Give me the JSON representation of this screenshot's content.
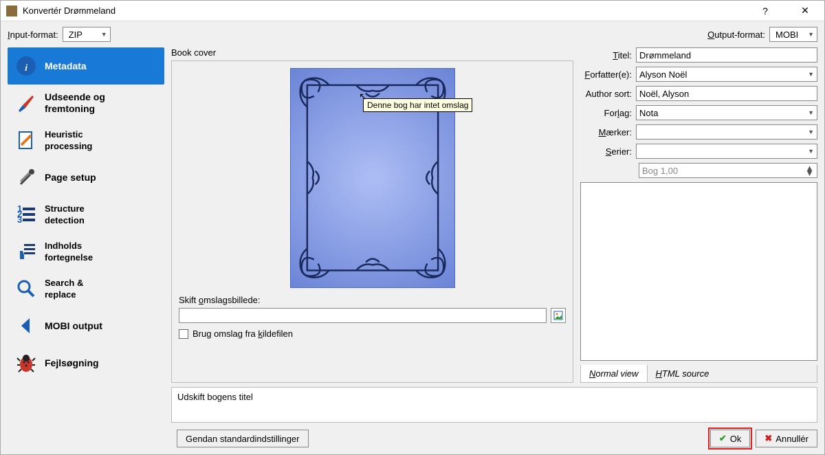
{
  "window": {
    "title": "Konvertér Drømmeland"
  },
  "formatbar": {
    "input_label_u": "I",
    "input_label_rest": "nput-format:",
    "input_value": "ZIP",
    "output_label_u": "O",
    "output_label_rest": "utput-format:",
    "output_value": "MOBI"
  },
  "sidebar": {
    "items": [
      {
        "label": "Metadata"
      },
      {
        "label": "Udseende og fremtoning"
      },
      {
        "label1": "Heuristic",
        "label2": "processing"
      },
      {
        "label": "Page setup"
      },
      {
        "label1": "Structure",
        "label2": "detection"
      },
      {
        "label1": "Indholds",
        "label2": "fortegnelse"
      },
      {
        "label1": "Search &",
        "label2": "replace"
      },
      {
        "label": "MOBI output"
      },
      {
        "label": "Fejlsøgning"
      }
    ]
  },
  "cover": {
    "heading": "Book cover",
    "tooltip": "Denne bog har intet omslag",
    "change_label_pre": "Skift ",
    "change_label_u": "o",
    "change_label_rest": "mslagsbillede:",
    "path_value": "",
    "checkbox_label_pre": "Brug omslag fra ",
    "checkbox_label_u": "k",
    "checkbox_label_rest": "ildefilen"
  },
  "meta": {
    "title_label_u": "T",
    "title_label_rest": "itel:",
    "title": "Drømmeland",
    "authors_label_u": "F",
    "authors_label_rest": "orfatter(e):",
    "authors": "Alyson Noël",
    "author_sort_label": "Author sort:",
    "author_sort": "Noël, Alyson",
    "publisher_label_pre": "For",
    "publisher_label_u": "l",
    "publisher_label_rest": "ag:",
    "publisher": "Nota",
    "tags_label_u": "M",
    "tags_label_rest": "ærker:",
    "tags": "",
    "series_label_u": "S",
    "series_label_rest": "erier:",
    "series": "",
    "series_index": "Bog 1,00",
    "tab1_u": "N",
    "tab1_rest": "ormal view",
    "tab2_u": "H",
    "tab2_rest": "TML source"
  },
  "status": {
    "text": "Udskift bogens titel"
  },
  "buttons": {
    "restore": "Gendan standardindstillinger",
    "ok": "Ok",
    "cancel": "Annullér"
  }
}
